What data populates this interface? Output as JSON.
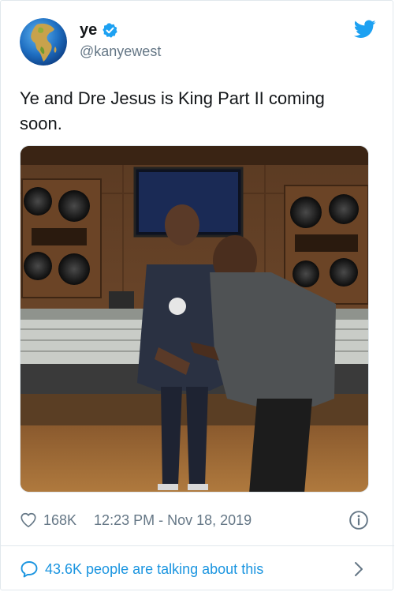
{
  "author": {
    "display_name": "ye",
    "handle": "@kanyewest",
    "verified": true,
    "avatar_icon": "globe-icon"
  },
  "brand_icon": "twitter-bird-icon",
  "tweet": {
    "text": "Ye and Dre Jesus is King Part II coming soon."
  },
  "photo": {
    "icon": "studio-photo"
  },
  "meta": {
    "likes": "168K",
    "timestamp": "12:23 PM - Nov 18, 2019"
  },
  "conversation": {
    "label": "43.6K people are talking about this"
  },
  "colors": {
    "accent": "#1da1f2",
    "link": "#1b95e0",
    "secondary_text": "#657786",
    "border": "#e1e8ed"
  }
}
